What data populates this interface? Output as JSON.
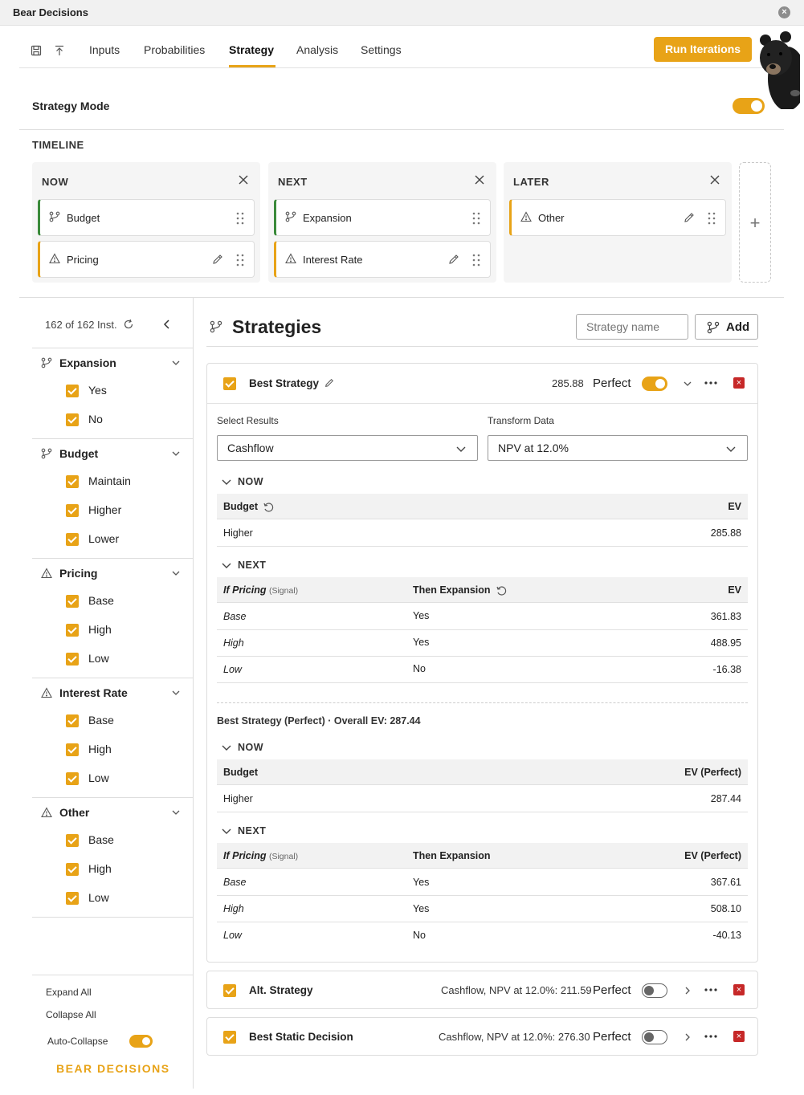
{
  "window": {
    "title": "Bear Decisions"
  },
  "nav": {
    "tabs": [
      {
        "label": "Inputs"
      },
      {
        "label": "Probabilities"
      },
      {
        "label": "Strategy"
      },
      {
        "label": "Analysis"
      },
      {
        "label": "Settings"
      }
    ],
    "active_tab": "Strategy",
    "run_label": "Run Iterations"
  },
  "strategy_mode": {
    "label": "Strategy Mode",
    "enabled": true
  },
  "timeline": {
    "title": "TIMELINE",
    "columns": [
      {
        "header": "NOW",
        "items": [
          {
            "label": "Budget",
            "kind": "decision"
          },
          {
            "label": "Pricing",
            "kind": "uncertainty"
          }
        ]
      },
      {
        "header": "NEXT",
        "items": [
          {
            "label": "Expansion",
            "kind": "decision"
          },
          {
            "label": "Interest Rate",
            "kind": "uncertainty"
          }
        ]
      },
      {
        "header": "LATER",
        "items": [
          {
            "label": "Other",
            "kind": "uncertainty"
          }
        ]
      }
    ],
    "add_label": "+"
  },
  "sidebar": {
    "instances": "162 of 162 Inst.",
    "groups": [
      {
        "name": "Expansion",
        "kind": "decision",
        "options": [
          "Yes",
          "No"
        ]
      },
      {
        "name": "Budget",
        "kind": "decision",
        "options": [
          "Maintain",
          "Higher",
          "Lower"
        ]
      },
      {
        "name": "Pricing",
        "kind": "uncertainty",
        "options": [
          "Base",
          "High",
          "Low"
        ]
      },
      {
        "name": "Interest Rate",
        "kind": "uncertainty",
        "options": [
          "Base",
          "High",
          "Low"
        ]
      },
      {
        "name": "Other",
        "kind": "uncertainty",
        "options": [
          "Base",
          "High",
          "Low"
        ]
      }
    ],
    "expand_all": "Expand All",
    "collapse_all": "Collapse All",
    "auto_collapse": "Auto-Collapse",
    "brand": "BEAR DECISIONS"
  },
  "strategies": {
    "title": "Strategies",
    "name_placeholder": "Strategy name",
    "add_label": "Add",
    "best": {
      "name": "Best Strategy",
      "value": "285.88",
      "perfect_label": "Perfect",
      "perfect_on": true,
      "select_results_label": "Select Results",
      "select_results_value": "Cashflow",
      "transform_label": "Transform Data",
      "transform_value": "NPV at 12.0%",
      "now": {
        "label": "NOW",
        "col1": "Budget",
        "col_ev": "EV",
        "rows": [
          {
            "c1": "Higher",
            "ev": "285.88"
          }
        ]
      },
      "next": {
        "label": "NEXT",
        "col1": "If Pricing",
        "col1_sub": "(Signal)",
        "col2": "Then Expansion",
        "col_ev": "EV",
        "rows": [
          {
            "c1": "Base",
            "c2": "Yes",
            "ev": "361.83"
          },
          {
            "c1": "High",
            "c2": "Yes",
            "ev": "488.95"
          },
          {
            "c1": "Low",
            "c2": "No",
            "ev": "-16.38"
          }
        ]
      },
      "perfect_summary": "Best Strategy (Perfect) · Overall EV: 287.44",
      "perfect_now": {
        "label": "NOW",
        "col1": "Budget",
        "col_ev": "EV (Perfect)",
        "rows": [
          {
            "c1": "Higher",
            "ev": "287.44"
          }
        ]
      },
      "perfect_next": {
        "label": "NEXT",
        "col1": "If Pricing",
        "col1_sub": "(Signal)",
        "col2": "Then Expansion",
        "col_ev": "EV (Perfect)",
        "rows": [
          {
            "c1": "Base",
            "c2": "Yes",
            "ev": "367.61"
          },
          {
            "c1": "High",
            "c2": "Yes",
            "ev": "508.10"
          },
          {
            "c1": "Low",
            "c2": "No",
            "ev": "-40.13"
          }
        ]
      }
    },
    "others": [
      {
        "name": "Alt. Strategy",
        "summary": "Cashflow, NPV at 12.0%: 211.59",
        "perfect_label": "Perfect",
        "perfect_on": false
      },
      {
        "name": "Best Static Decision",
        "summary": "Cashflow, NPV at 12.0%: 276.30",
        "perfect_label": "Perfect",
        "perfect_on": false
      }
    ]
  },
  "colors": {
    "accent": "#e8a317",
    "decision": "#3a8a3a",
    "delete": "#c62828"
  }
}
